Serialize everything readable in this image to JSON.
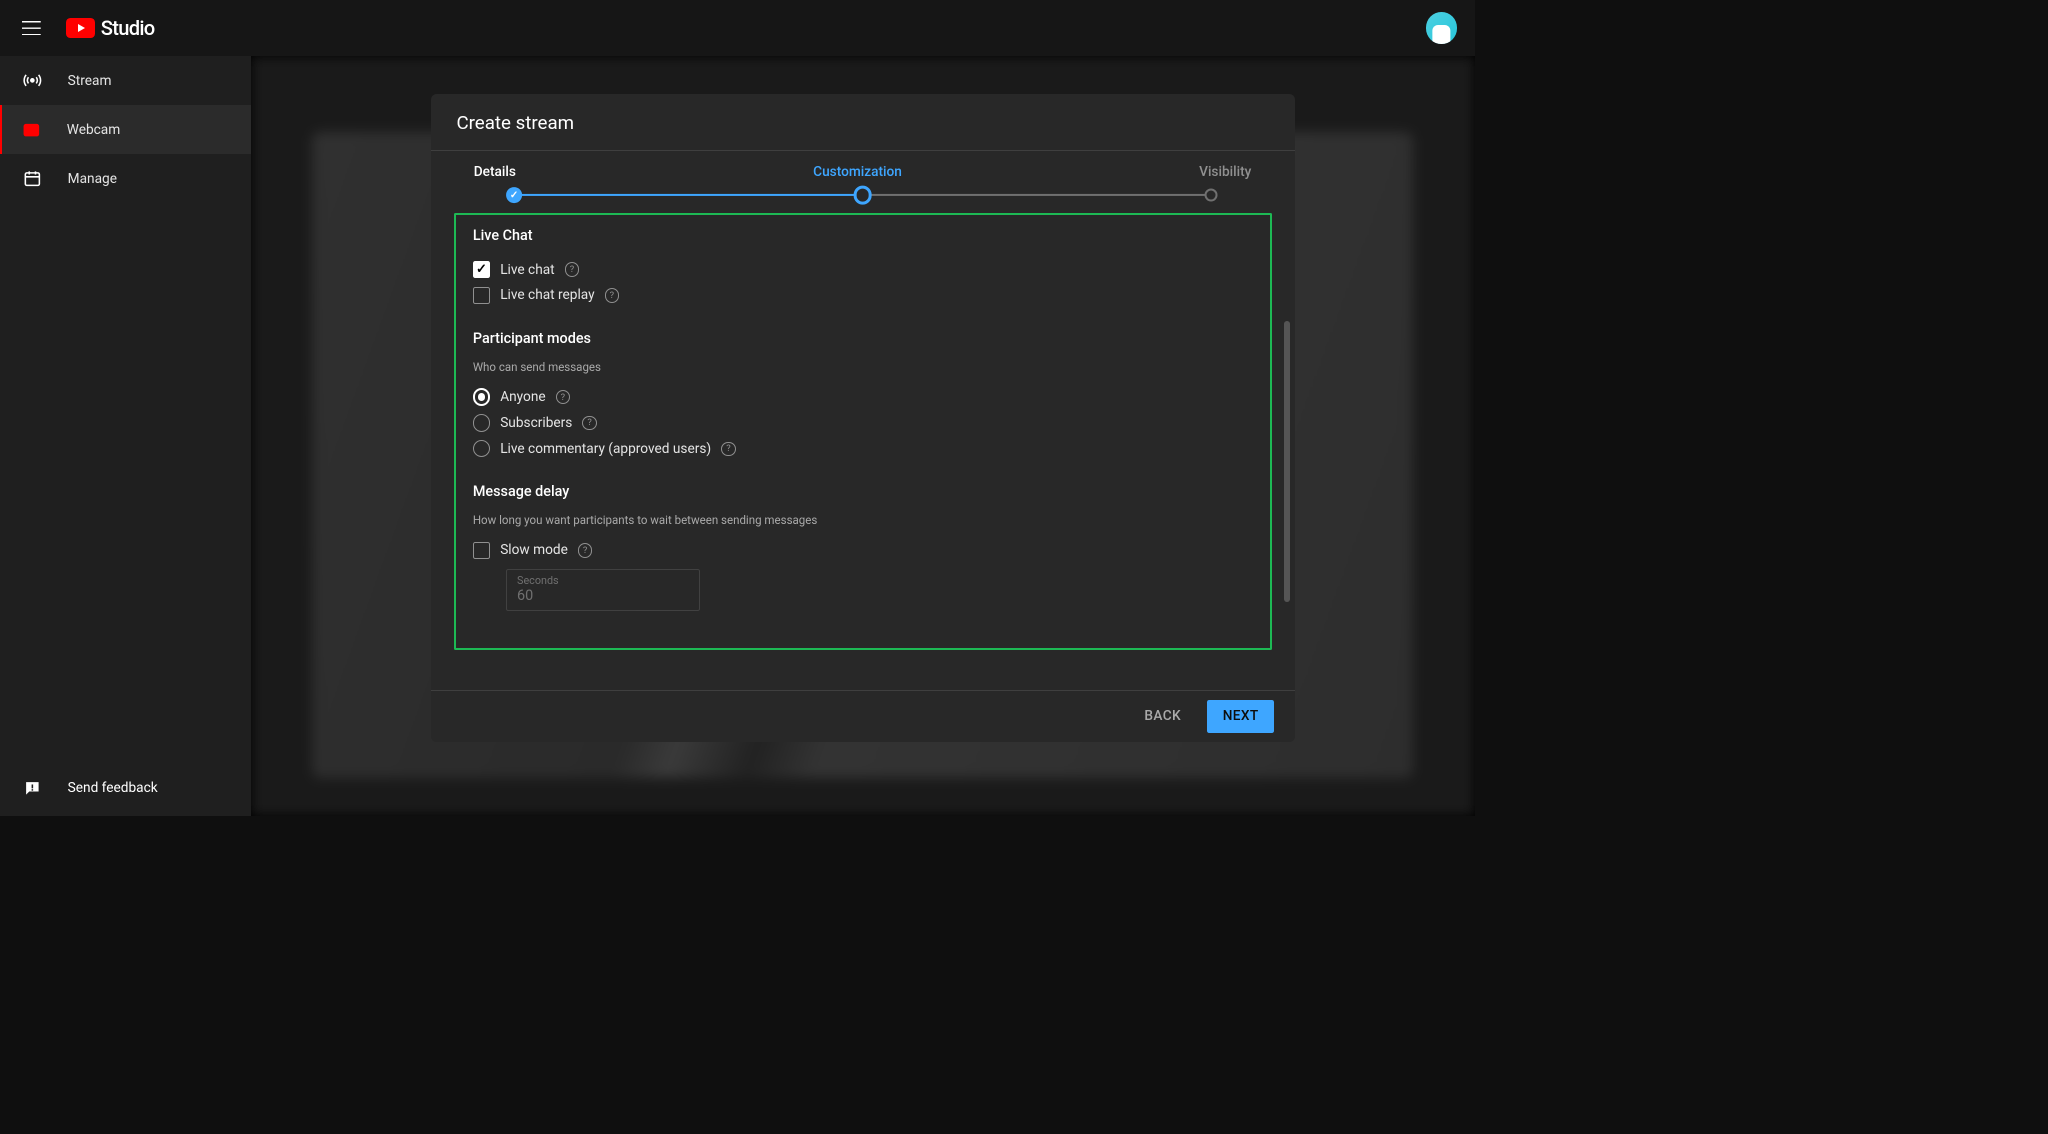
{
  "header": {
    "logo_text": "Studio"
  },
  "sidebar": {
    "items": [
      {
        "label": "Stream"
      },
      {
        "label": "Webcam"
      },
      {
        "label": "Manage"
      }
    ],
    "feedback_label": "Send feedback"
  },
  "dialog": {
    "title": "Create stream",
    "steps": [
      {
        "label": "Details",
        "state": "done"
      },
      {
        "label": "Customization",
        "state": "current"
      },
      {
        "label": "Visibility",
        "state": "future"
      }
    ],
    "live_chat": {
      "title": "Live Chat",
      "options": [
        {
          "label": "Live chat",
          "checked": true
        },
        {
          "label": "Live chat replay",
          "checked": false
        }
      ]
    },
    "participant_modes": {
      "title": "Participant modes",
      "description": "Who can send messages",
      "options": [
        {
          "label": "Anyone",
          "selected": true
        },
        {
          "label": "Subscribers",
          "selected": false
        },
        {
          "label": "Live commentary (approved users)",
          "selected": false
        }
      ]
    },
    "message_delay": {
      "title": "Message delay",
      "description": "How long you want participants to wait between sending messages",
      "slow_mode_label": "Slow mode",
      "slow_mode_checked": false,
      "seconds_label": "Seconds",
      "seconds_value": "60"
    },
    "buttons": {
      "back": "BACK",
      "next": "NEXT"
    }
  }
}
